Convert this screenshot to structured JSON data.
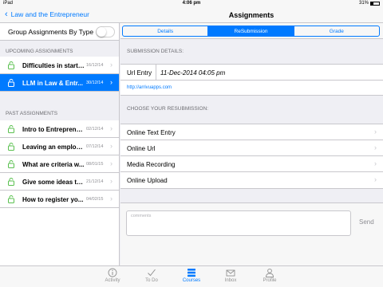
{
  "status": {
    "carrier": "iPad",
    "time": "4:06 pm",
    "battery": "31%"
  },
  "nav": {
    "back_label": "Law and the Entrepreneur",
    "title": "Assignments"
  },
  "left": {
    "group_label": "Group Assignments By Type",
    "upcoming_header": "UPCOMING ASSIGNMENTS",
    "upcoming": [
      {
        "title": "Difficulties in starti...",
        "date": "16/12/14",
        "selected": false
      },
      {
        "title": "LLM in Law & Entr...",
        "date": "30/12/14",
        "selected": true
      }
    ],
    "past_header": "PAST ASSIGNMENTS",
    "past": [
      {
        "title": "Intro to Entreprene...",
        "date": "02/12/14"
      },
      {
        "title": "Leaving an employ...",
        "date": "07/12/14"
      },
      {
        "title": "What are criteria w...",
        "date": "08/01/15"
      },
      {
        "title": "Give some ideas to...",
        "date": "21/12/14"
      },
      {
        "title": "How to register yo...",
        "date": "04/02/15"
      }
    ]
  },
  "right": {
    "tabs": [
      "Details",
      "ReSubmission",
      "Grade"
    ],
    "active_tab": "ReSubmission",
    "submission_header": "SUBMISSION DETAILS:",
    "url_label": "Url Entry",
    "url_value": "11-Dec-2014 04:05 pm",
    "url_link": "http://arrivuapps.com",
    "choose_header": "CHOOSE YOUR RESUBMISSION:",
    "options": [
      "Online Text Entry",
      "Online Url",
      "Media Recording",
      "Online Upload"
    ],
    "comments_placeholder": "comments",
    "send_label": "Send"
  },
  "tabbar": {
    "items": [
      {
        "label": "Activity",
        "icon": "info-icon"
      },
      {
        "label": "To Do",
        "icon": "checkmark-icon"
      },
      {
        "label": "Courses",
        "icon": "stack-icon"
      },
      {
        "label": "Inbox",
        "icon": "envelope-icon"
      },
      {
        "label": "Profile",
        "icon": "person-icon"
      }
    ],
    "active": "Courses"
  },
  "colors": {
    "accent": "#007aff",
    "background": "#efeff4"
  }
}
